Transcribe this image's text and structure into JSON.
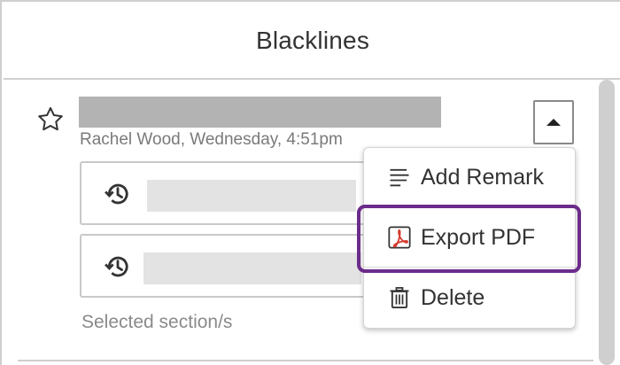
{
  "panel": {
    "title": "Blacklines"
  },
  "entry": {
    "starred": false,
    "meta": "Rachel Wood, Wednesday, 4:51pm",
    "toggle_icon": "caret-up-icon",
    "versions": [
      {
        "icon": "history-icon"
      },
      {
        "icon": "history-icon"
      }
    ],
    "selected_label": "Selected section/s"
  },
  "menu": {
    "items": [
      {
        "label": "Add Remark",
        "icon": "remark-icon"
      },
      {
        "label": "Export PDF",
        "icon": "pdf-icon",
        "highlighted": true
      },
      {
        "label": "Delete",
        "icon": "trash-icon"
      }
    ]
  },
  "colors": {
    "highlight": "#6b2c8a",
    "pdf_red": "#d63b2e",
    "placeholder_dark": "#b3b3b3",
    "placeholder_light": "#e3e3e3"
  }
}
